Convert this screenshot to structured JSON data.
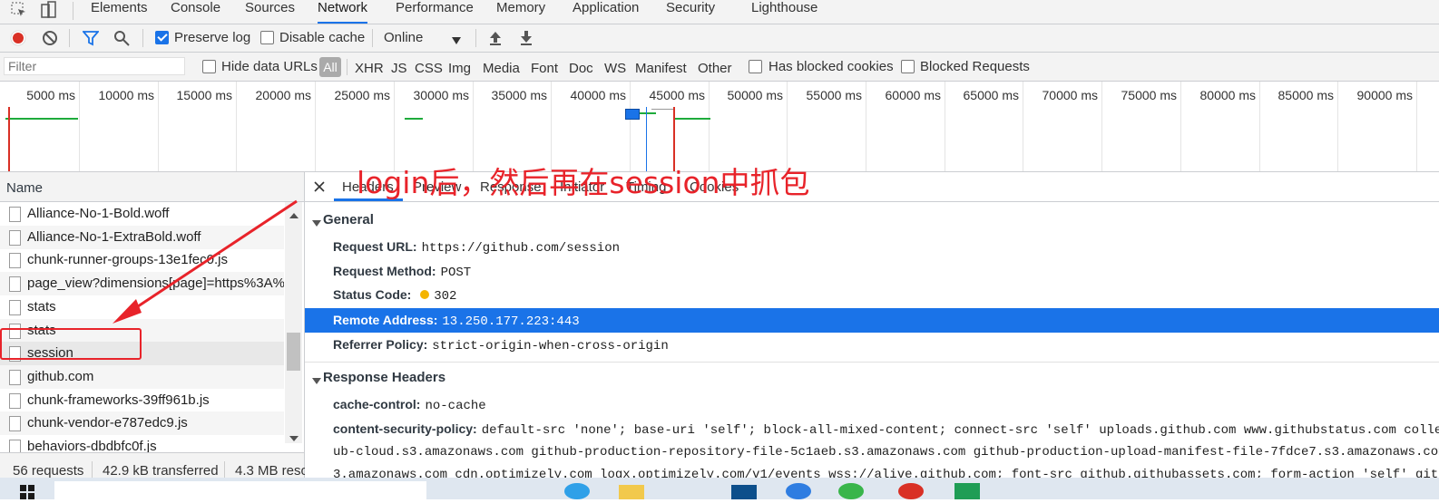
{
  "devtools_tabs": [
    "Elements",
    "Console",
    "Sources",
    "Network",
    "Performance",
    "Memory",
    "Application",
    "Security",
    "Lighthouse"
  ],
  "active_tab": "Network",
  "toolbar": {
    "preserve_log": "Preserve log",
    "disable_cache": "Disable cache",
    "throttle": "Online"
  },
  "filterbar": {
    "placeholder": "Filter",
    "hide_data_urls": "Hide data URLs",
    "types": [
      "All",
      "XHR",
      "JS",
      "CSS",
      "Img",
      "Media",
      "Font",
      "Doc",
      "WS",
      "Manifest",
      "Other"
    ],
    "has_blocked_cookies": "Has blocked cookies",
    "blocked_requests": "Blocked Requests"
  },
  "timeline_ticks": [
    "5000 ms",
    "10000 ms",
    "15000 ms",
    "20000 ms",
    "25000 ms",
    "30000 ms",
    "35000 ms",
    "40000 ms",
    "45000 ms",
    "50000 ms",
    "55000 ms",
    "60000 ms",
    "65000 ms",
    "70000 ms",
    "75000 ms",
    "80000 ms",
    "85000 ms",
    "90000 ms"
  ],
  "annotation": "login后，然后再在session中抓包",
  "requests": {
    "header": "Name",
    "items": [
      "Alliance-No-1-Bold.woff",
      "Alliance-No-1-ExtraBold.woff",
      "chunk-runner-groups-13e1fec0.js",
      "page_view?dimensions[page]=https%3A%2",
      "stats",
      "stats",
      "session",
      "github.com",
      "chunk-frameworks-39ff961b.js",
      "chunk-vendor-e787edc9.js",
      "behaviors-dbdbfc0f.js"
    ],
    "status": {
      "requests": "56 requests",
      "transferred": "42.9 kB transferred",
      "resources": "4.3 MB reso"
    }
  },
  "detail_tabs": [
    "Headers",
    "Preview",
    "Response",
    "Initiator",
    "Timing",
    "Cookies"
  ],
  "general": {
    "title": "General",
    "request_url_k": "Request URL:",
    "request_url_v": "https://github.com/session",
    "request_method_k": "Request Method:",
    "request_method_v": "POST",
    "status_code_k": "Status Code:",
    "status_code_v": "302",
    "remote_address_k": "Remote Address:",
    "remote_address_v": "13.250.177.223:443",
    "referrer_policy_k": "Referrer Policy:",
    "referrer_policy_v": "strict-origin-when-cross-origin"
  },
  "response_headers": {
    "title": "Response Headers",
    "cache_control_k": "cache-control:",
    "cache_control_v": "no-cache",
    "csp_k": "content-security-policy:",
    "csp_v1": "default-src 'none'; base-uri 'self'; block-all-mixed-content; connect-src 'self' uploads.github.com www.githubstatus.com colle",
    "csp_v2": "ub-cloud.s3.amazonaws.com github-production-repository-file-5c1aeb.s3.amazonaws.com github-production-upload-manifest-file-7fdce7.s3.amazonaws.com g",
    "csp_v3": "3.amazonaws.com cdn.optimizely.com logx.optimizely.com/v1/events wss://alive.github.com; font-src github.githubassets.com; form-action 'self' github"
  },
  "colors": {
    "accent": "#1a73e8",
    "annotation_red": "#e8232a",
    "record_red": "#d93025"
  }
}
